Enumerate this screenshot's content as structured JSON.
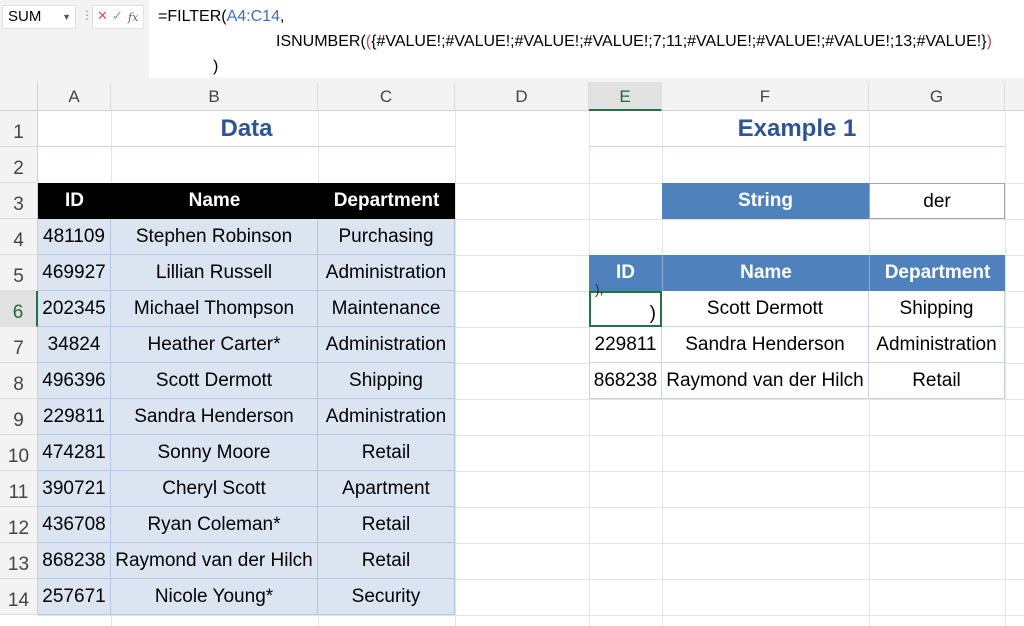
{
  "formula_bar": {
    "name_box": "SUM",
    "line1_fn": "=FILTER(",
    "line1_ref": "A4:C14",
    "line1_end": ",",
    "line2_fn": "ISNUMBER(",
    "line2_open": "(",
    "line2_array": "{#VALUE!;#VALUE!;#VALUE!;#VALUE!;7;11;#VALUE!;#VALUE!;#VALUE!;13;#VALUE!}",
    "line2_close": ")",
    "line3": ")"
  },
  "columns": [
    "A",
    "B",
    "C",
    "D",
    "E",
    "F",
    "G"
  ],
  "selected_column": "E",
  "rows": [
    "1",
    "2",
    "3",
    "4",
    "5",
    "6",
    "7",
    "8",
    "9",
    "10",
    "11",
    "12",
    "13",
    "14"
  ],
  "selected_row": "6",
  "data_table": {
    "title": "Data",
    "headers": [
      "ID",
      "Name",
      "Department"
    ],
    "rows": [
      [
        "481109",
        "Stephen Robinson",
        "Purchasing"
      ],
      [
        "469927",
        "Lillian Russell",
        "Administration"
      ],
      [
        "202345",
        "Michael Thompson",
        "Maintenance"
      ],
      [
        "34824",
        "Heather Carter*",
        "Administration"
      ],
      [
        "496396",
        "Scott Dermott",
        "Shipping"
      ],
      [
        "229811",
        "Sandra Henderson",
        "Administration"
      ],
      [
        "474281",
        "Sonny Moore",
        "Retail"
      ],
      [
        "390721",
        "Cheryl Scott",
        "Apartment"
      ],
      [
        "436708",
        "Ryan Coleman*",
        "Retail"
      ],
      [
        "868238",
        "Raymond van der Hilch",
        "Retail"
      ],
      [
        "257671",
        "Nicole Young*",
        "Security"
      ]
    ]
  },
  "example": {
    "title": "Example 1",
    "string_label": "String",
    "string_value": "der",
    "headers": [
      "ID",
      "Name",
      "Department"
    ],
    "editing_cell_tail": "),",
    "editing_cell_text": ")",
    "rows": [
      [
        "",
        "Scott Dermott",
        "Shipping"
      ],
      [
        "229811",
        "Sandra Henderson",
        "Administration"
      ],
      [
        "868238",
        "Raymond van der Hilch",
        "Retail"
      ]
    ]
  },
  "colors": {
    "title": "#2f5496",
    "header_black": "#000000",
    "header_blue": "#4f81bd",
    "data_fill": "#dbe5f1",
    "selection": "#217346"
  }
}
